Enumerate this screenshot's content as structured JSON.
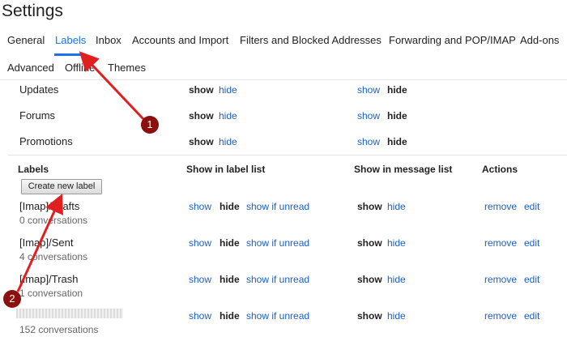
{
  "title": "Settings",
  "tabs_row1": [
    "General",
    "Labels",
    "Inbox",
    "Accounts and Import",
    "Filters and Blocked Addresses",
    "Forwarding and POP/IMAP",
    "Add-ons"
  ],
  "tabs_row2": [
    "Advanced",
    "Offline",
    "Themes"
  ],
  "active_tab": "Labels",
  "categories": [
    {
      "name": "Updates",
      "list_show": "show",
      "list_hide": "hide",
      "msg_show": "show",
      "msg_hide": "hide"
    },
    {
      "name": "Forums",
      "list_show": "show",
      "list_hide": "hide",
      "msg_show": "show",
      "msg_hide": "hide"
    },
    {
      "name": "Promotions",
      "list_show": "show",
      "list_hide": "hide",
      "msg_show": "show",
      "msg_hide": "hide"
    }
  ],
  "labels_header": {
    "labels": "Labels",
    "show_in_label_list": "Show in label list",
    "show_in_message_list": "Show in message list",
    "actions": "Actions"
  },
  "create_label_button": "Create new label",
  "labels": [
    {
      "name": "[Imap]/Drafts",
      "count": "0 conversations",
      "show": "show",
      "hide": "hide",
      "show_if_unread": "show if unread",
      "msg_show": "show",
      "msg_hide": "hide",
      "remove": "remove",
      "edit": "edit"
    },
    {
      "name": "[Imap]/Sent",
      "count": "4 conversations",
      "show": "show",
      "hide": "hide",
      "show_if_unread": "show if unread",
      "msg_show": "show",
      "msg_hide": "hide",
      "remove": "remove",
      "edit": "edit"
    },
    {
      "name": "[Imap]/Trash",
      "count": "1 conversation",
      "show": "show",
      "hide": "hide",
      "show_if_unread": "show if unread",
      "msg_show": "show",
      "msg_hide": "hide",
      "remove": "remove",
      "edit": "edit"
    },
    {
      "name": "",
      "count": "152 conversations",
      "show": "show",
      "hide": "hide",
      "show_if_unread": "show if unread",
      "msg_show": "show",
      "msg_hide": "hide",
      "remove": "remove",
      "edit": "edit"
    }
  ],
  "annotations": [
    "1",
    "2"
  ],
  "colors": {
    "accent": "#1a73e8",
    "link": "#1a5fc8",
    "annotation": "#8b1010",
    "arrow": "#e02020"
  }
}
